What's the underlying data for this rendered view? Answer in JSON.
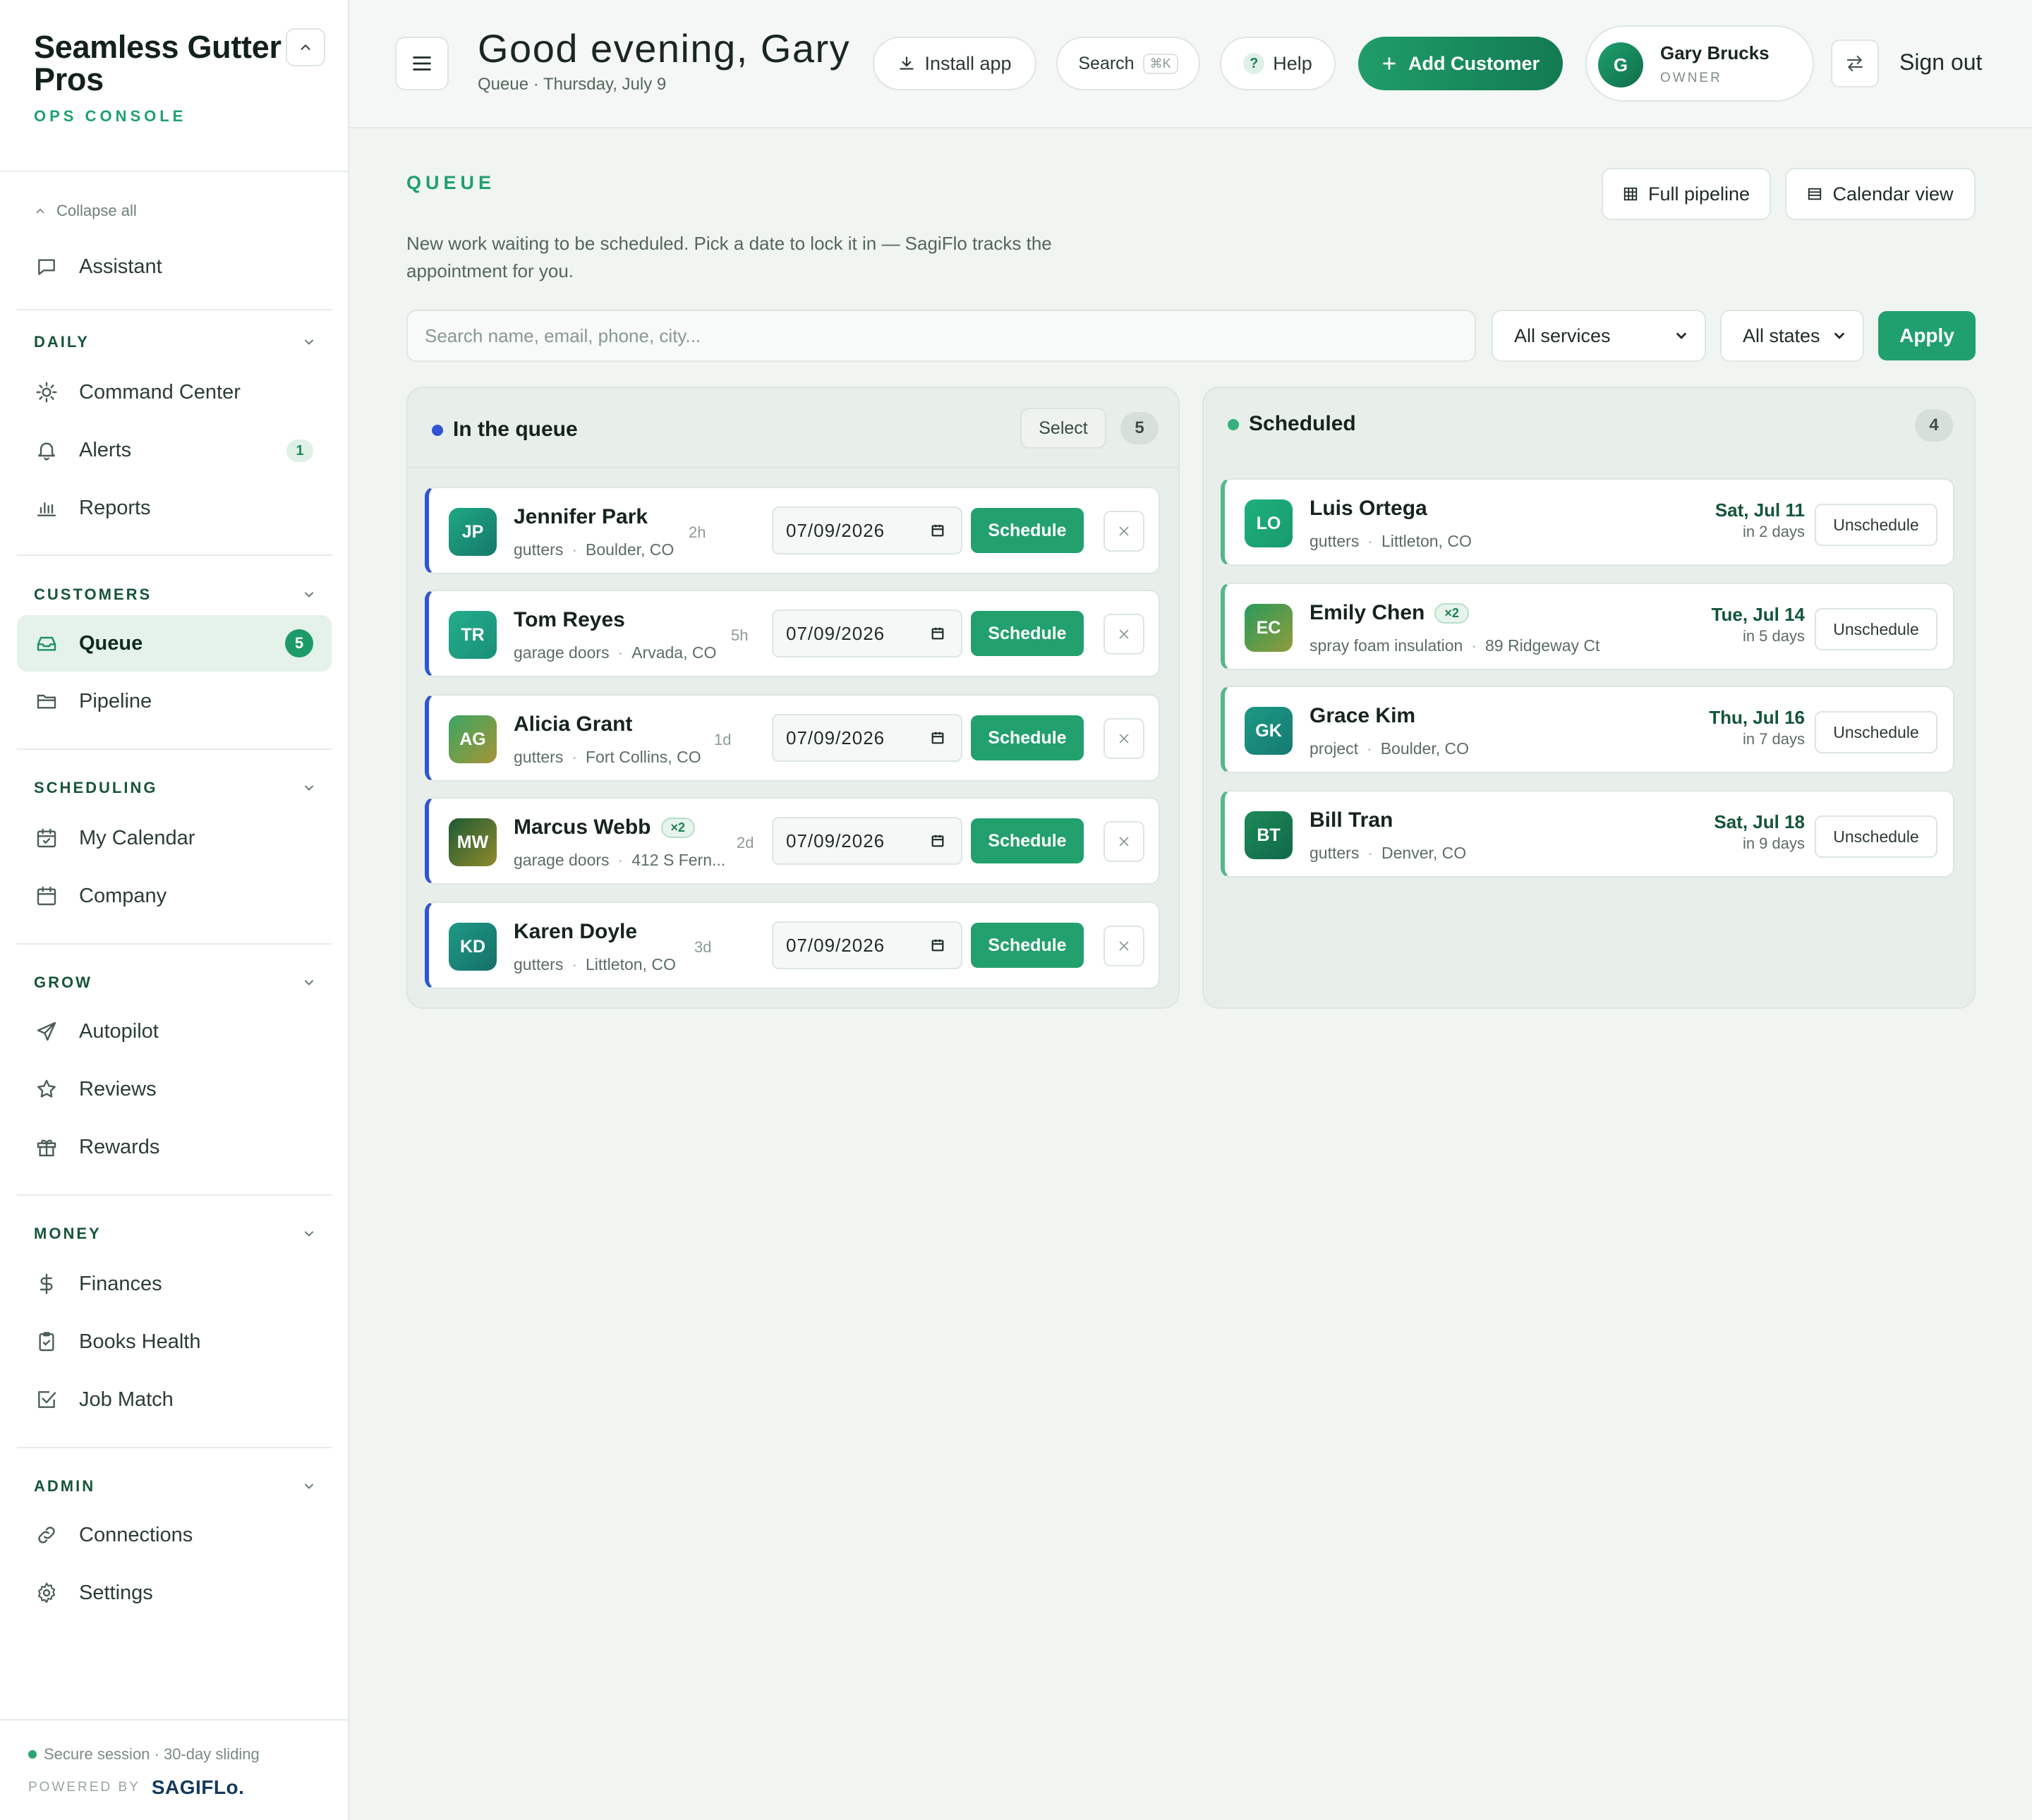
{
  "brand": {
    "name": "Seamless Gutter Pros",
    "subtitle": "OPS CONSOLE"
  },
  "sidebar": {
    "collapse_all": "Collapse all",
    "assistant": "Assistant",
    "sections": {
      "daily": {
        "title": "DAILY",
        "items": [
          {
            "label": "Command Center",
            "icon": "sun-icon"
          },
          {
            "label": "Alerts",
            "icon": "bell-icon",
            "badge": "1"
          },
          {
            "label": "Reports",
            "icon": "bar-chart-icon"
          }
        ]
      },
      "customers": {
        "title": "CUSTOMERS",
        "items": [
          {
            "label": "Queue",
            "icon": "inbox-icon",
            "badge": "5",
            "active": true
          },
          {
            "label": "Pipeline",
            "icon": "folder-icon"
          }
        ]
      },
      "scheduling": {
        "title": "SCHEDULING",
        "items": [
          {
            "label": "My Calendar",
            "icon": "calendar-check-icon"
          },
          {
            "label": "Company",
            "icon": "calendar-icon"
          }
        ]
      },
      "grow": {
        "title": "GROW",
        "items": [
          {
            "label": "Autopilot",
            "icon": "send-icon"
          },
          {
            "label": "Reviews",
            "icon": "star-icon"
          },
          {
            "label": "Rewards",
            "icon": "gift-icon"
          }
        ]
      },
      "money": {
        "title": "MONEY",
        "items": [
          {
            "label": "Finances",
            "icon": "dollar-icon"
          },
          {
            "label": "Books Health",
            "icon": "clipboard-check-icon"
          },
          {
            "label": "Job Match",
            "icon": "checkbox-icon"
          }
        ]
      },
      "admin": {
        "title": "ADMIN",
        "items": [
          {
            "label": "Connections",
            "icon": "link-icon"
          },
          {
            "label": "Settings",
            "icon": "gear-icon"
          }
        ]
      }
    },
    "footer": {
      "session": "Secure session · 30-day sliding",
      "powered_by": "POWERED BY",
      "logo": "SAGIFLo."
    }
  },
  "topbar": {
    "greeting": "Good evening, Gary",
    "subtitle": "Queue · Thursday, July 9",
    "install": "Install app",
    "search": "Search",
    "search_kbd": "⌘K",
    "help": "Help",
    "add_customer": "Add Customer",
    "user": {
      "initial": "G",
      "name": "Gary Brucks",
      "role": "OWNER"
    },
    "sign_out": "Sign out"
  },
  "main": {
    "label": "QUEUE",
    "description": "New work waiting to be scheduled. Pick a date to lock it in — SagiFlo tracks the appointment for you.",
    "full_pipeline": "Full pipeline",
    "calendar_view": "Calendar view",
    "search_placeholder": "Search name, email, phone, city...",
    "services_filter": "All services",
    "states_filter": "All states",
    "apply": "Apply"
  },
  "queue_column": {
    "title": "In the queue",
    "select": "Select",
    "count": "5",
    "schedule_label": "Schedule",
    "items": [
      {
        "initials": "JP",
        "name": "Jennifer Park",
        "service": "gutters",
        "location": "Boulder, CO",
        "age": "2h",
        "date": "07/09/2026",
        "multi": ""
      },
      {
        "initials": "TR",
        "name": "Tom Reyes",
        "service": "garage doors",
        "location": "Arvada, CO",
        "age": "5h",
        "date": "07/09/2026",
        "multi": ""
      },
      {
        "initials": "AG",
        "name": "Alicia Grant",
        "service": "gutters",
        "location": "Fort Collins, CO",
        "age": "1d",
        "date": "07/09/2026",
        "multi": ""
      },
      {
        "initials": "MW",
        "name": "Marcus Webb",
        "service": "garage doors",
        "location": "412 S Fern...",
        "age": "2d",
        "date": "07/09/2026",
        "multi": "×2"
      },
      {
        "initials": "KD",
        "name": "Karen Doyle",
        "service": "gutters",
        "location": "Littleton, CO",
        "age": "3d",
        "date": "07/09/2026",
        "multi": ""
      }
    ]
  },
  "scheduled_column": {
    "title": "Scheduled",
    "count": "4",
    "unschedule_label": "Unschedule",
    "items": [
      {
        "initials": "LO",
        "name": "Luis Ortega",
        "service": "gutters",
        "location": "Littleton, CO",
        "date": "Sat, Jul 11",
        "in": "in 2 days",
        "multi": ""
      },
      {
        "initials": "EC",
        "name": "Emily Chen",
        "service": "spray foam insulation",
        "location": "89 Ridgeway Ct",
        "date": "Tue, Jul 14",
        "in": "in 5 days",
        "multi": "×2"
      },
      {
        "initials": "GK",
        "name": "Grace Kim",
        "service": "project",
        "location": "Boulder, CO",
        "date": "Thu, Jul 16",
        "in": "in 7 days",
        "multi": ""
      },
      {
        "initials": "BT",
        "name": "Bill Tran",
        "service": "gutters",
        "location": "Denver, CO",
        "date": "Sat, Jul 18",
        "in": "in 9 days",
        "multi": ""
      }
    ]
  },
  "colors": {
    "accent": "#1fa06e",
    "queue_blue": "#2f55d4",
    "dark_green": "#137a52"
  }
}
